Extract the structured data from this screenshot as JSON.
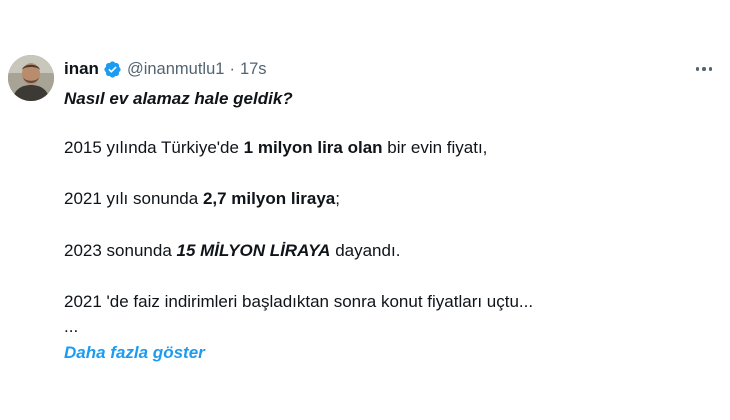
{
  "author": {
    "display_name": "inan",
    "handle": "@inanmutlu1",
    "separator": "·",
    "time": "17s",
    "verified_color": "#1d9bf0"
  },
  "tweet": {
    "headline": "Nasıl ev alamaz hale geldik?",
    "line2": {
      "prefix": "2015 yılında Türkiye'de ",
      "bold": "1 milyon lira olan",
      "suffix": " bir evin fiyatı,"
    },
    "line3": {
      "prefix": "2021 yılı sonunda ",
      "bold": "2,7 milyon liraya",
      "suffix": ";"
    },
    "line4": {
      "prefix": "2023 sonunda ",
      "bold": "15 MİLYON LİRAYA",
      "suffix": " dayandı."
    },
    "line5": "2021 'de faiz indirimleri başladıktan sonra konut fiyatları uçtu...",
    "line6": "...",
    "show_more": "Daha fazla göster"
  },
  "icons": {
    "verified": "verified-badge-icon",
    "more": "more-options-icon",
    "avatar": "profile-avatar"
  },
  "colors": {
    "text": "#0f1419",
    "secondary": "#536471",
    "link": "#1d9bf0"
  }
}
